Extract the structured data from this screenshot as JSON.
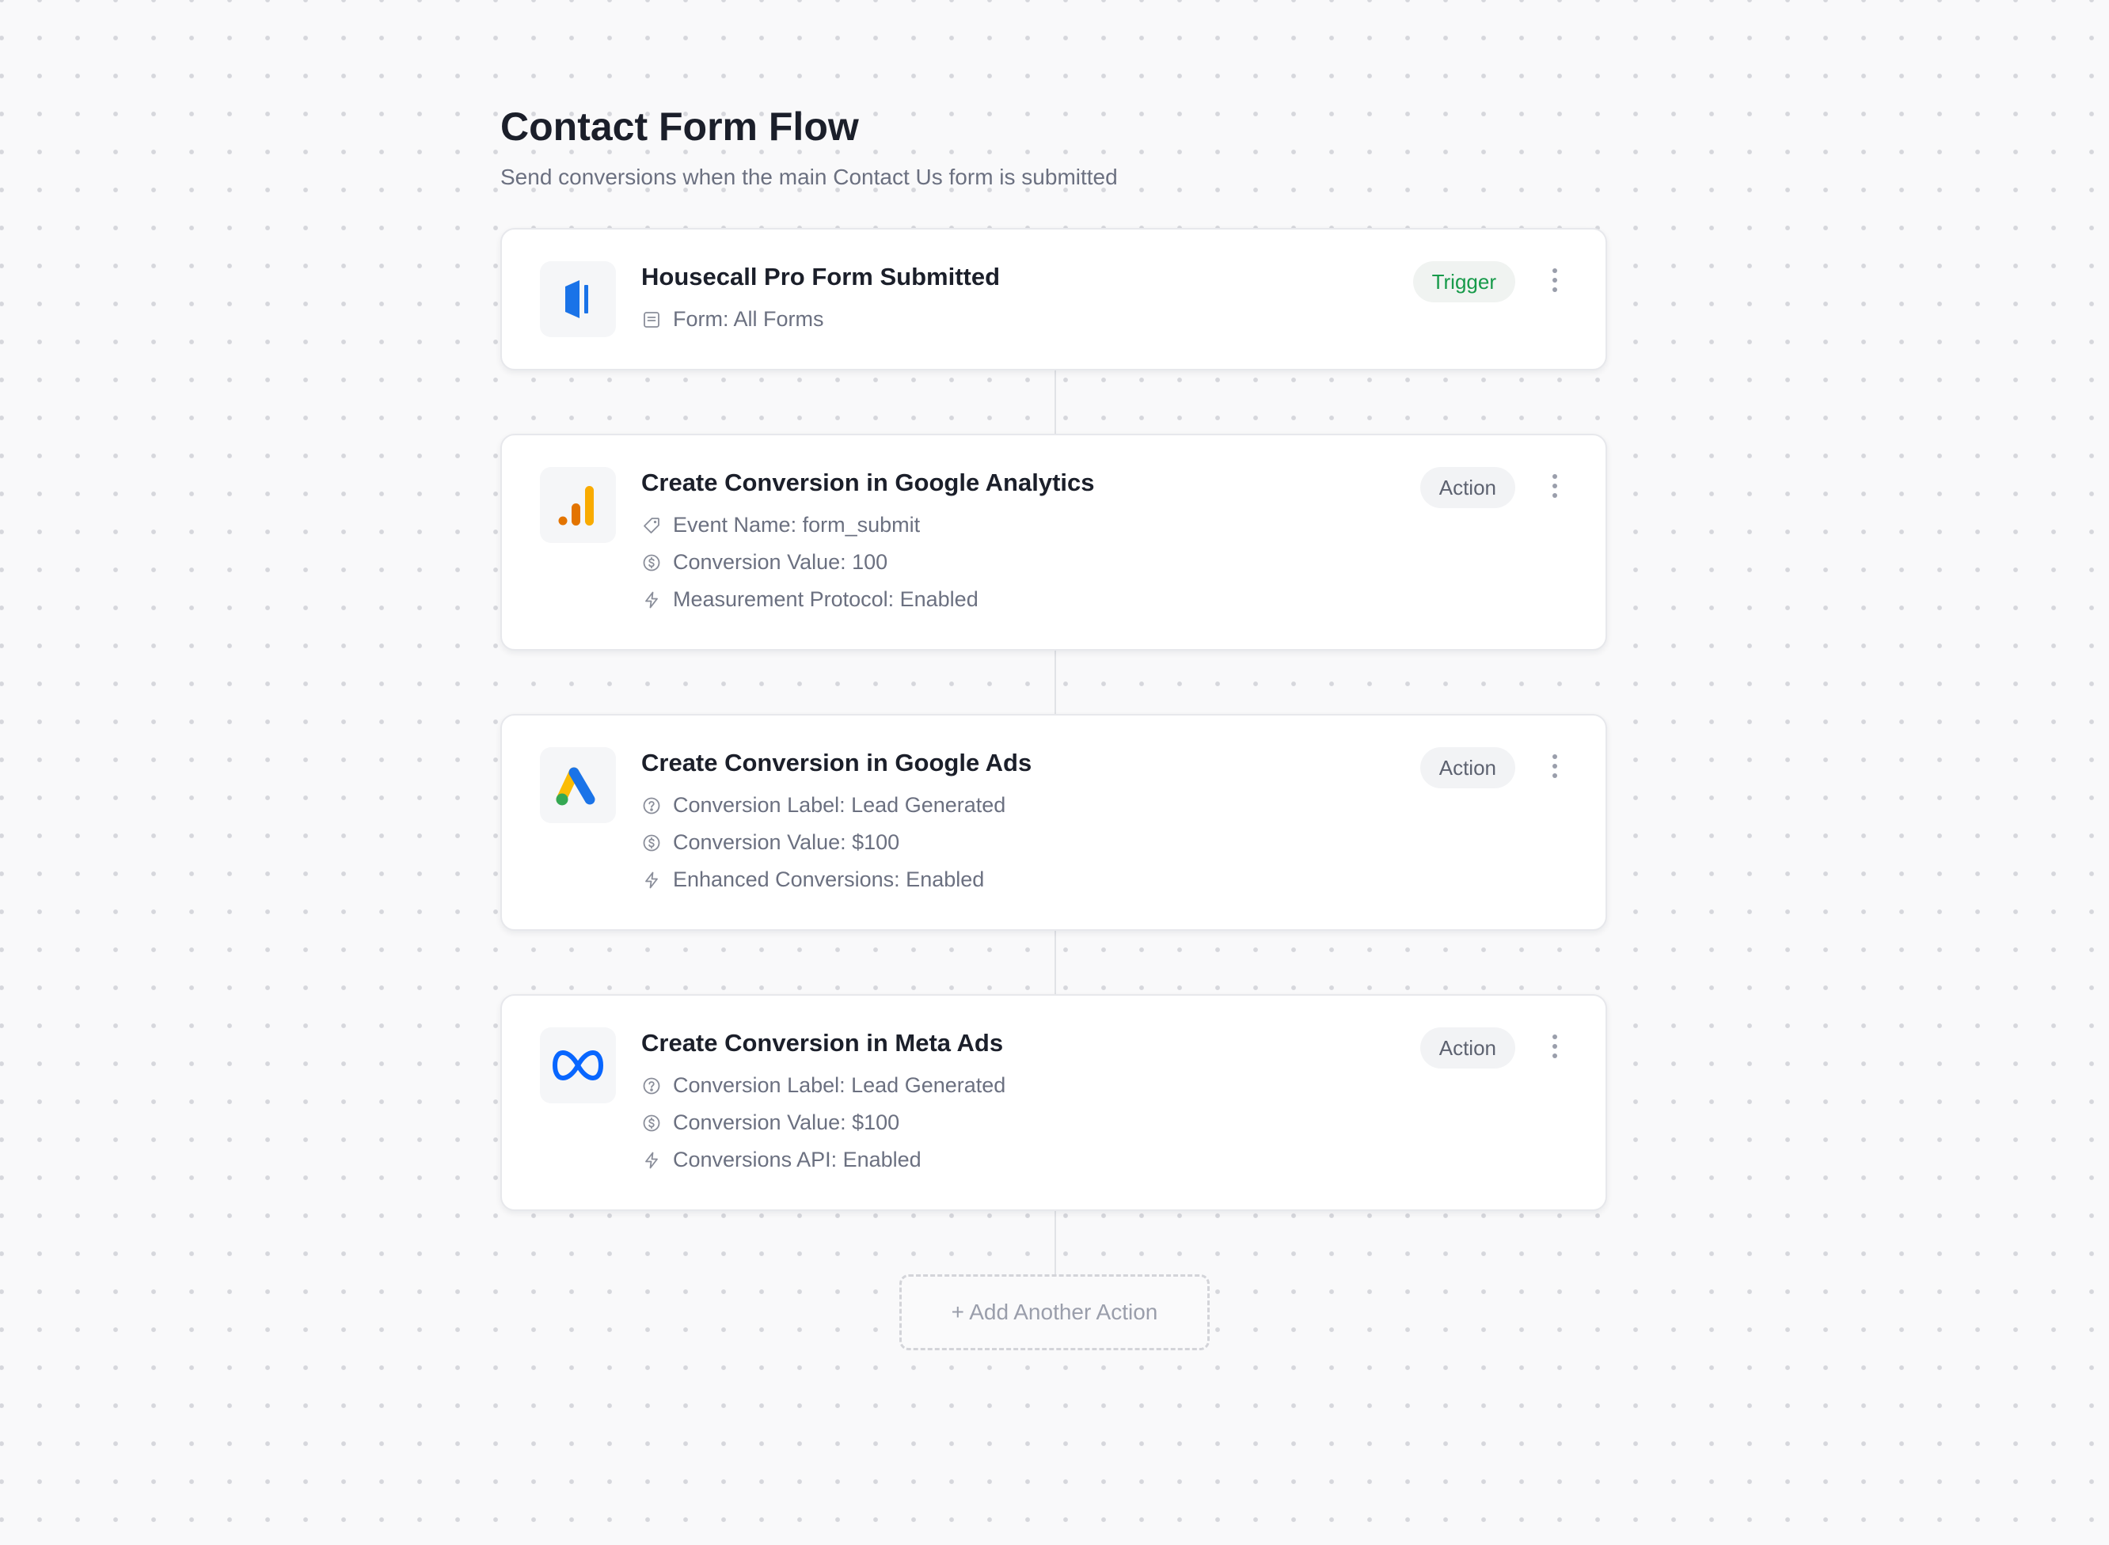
{
  "page": {
    "title": "Contact Form Flow",
    "subtitle": "Send conversions when the main Contact Us form is submitted"
  },
  "trigger": {
    "title": "Housecall Pro Form Submitted",
    "badge": "Trigger",
    "app_icon": "housecall-pro-logo",
    "details": [
      {
        "icon": "document-icon",
        "text": "Form: All Forms"
      }
    ]
  },
  "actions": [
    {
      "title": "Create Conversion in Google Analytics",
      "badge": "Action",
      "app_icon": "google-analytics-logo",
      "details": [
        {
          "icon": "tag-icon",
          "text": "Event Name: form_submit"
        },
        {
          "icon": "dollar-icon",
          "text": "Conversion Value: 100"
        },
        {
          "icon": "lightning-icon",
          "text": "Measurement Protocol: Enabled"
        }
      ]
    },
    {
      "title": "Create Conversion in Google Ads",
      "badge": "Action",
      "app_icon": "google-ads-logo",
      "details": [
        {
          "icon": "help-circle-icon",
          "text": "Conversion Label: Lead Generated"
        },
        {
          "icon": "dollar-icon",
          "text": "Conversion Value: $100"
        },
        {
          "icon": "lightning-icon",
          "text": "Enhanced Conversions: Enabled"
        }
      ]
    },
    {
      "title": "Create Conversion in Meta Ads",
      "badge": "Action",
      "app_icon": "meta-logo",
      "details": [
        {
          "icon": "help-circle-icon",
          "text": "Conversion Label: Lead Generated"
        },
        {
          "icon": "dollar-icon",
          "text": "Conversion Value: $100"
        },
        {
          "icon": "lightning-icon",
          "text": "Conversions API: Enabled"
        }
      ]
    }
  ],
  "add_action": {
    "label": "+ Add Another Action"
  },
  "colors": {
    "trigger_badge": "#179a4a",
    "housecall_blue": "#1a73e8",
    "google_orange": "#f9ab00",
    "google_dark_orange": "#e37400",
    "google_blue": "#1a73e8",
    "google_yellow": "#fbbc04",
    "google_green": "#34a853",
    "meta_blue": "#0866ff"
  }
}
